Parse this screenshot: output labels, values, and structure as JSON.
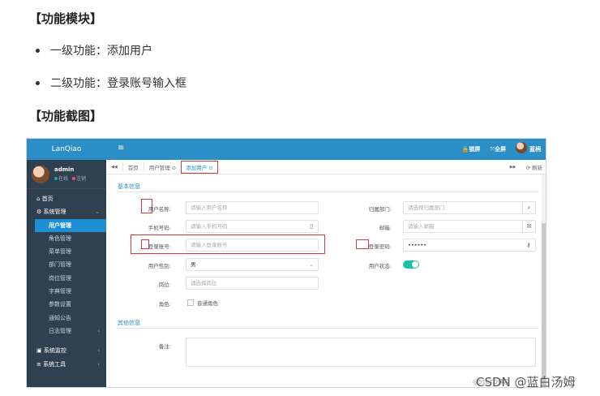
{
  "doc": {
    "heading1": "【功能模块】",
    "bullet1": "一级功能：添加用户",
    "bullet2": "二级功能：登录账号输入框",
    "heading2": "【功能截图】",
    "watermark": "CSDN @蓝白汤姆",
    "watermark_small": "@51CTO博客"
  },
  "app": {
    "brand": "LanQiao",
    "user_name": "admin",
    "user_status": "在线",
    "logout": "注销",
    "top_lock": "锁屏",
    "top_full": "全屏",
    "top_user": "蓝柄",
    "menu": [
      {
        "label": "首页",
        "type": "grp",
        "icon": "home-icon"
      },
      {
        "label": "系统管理",
        "type": "grp",
        "icon": "gear-icon",
        "arrow": "⌄"
      },
      {
        "label": "用户管理",
        "type": "active"
      },
      {
        "label": "角色管理",
        "type": "sub"
      },
      {
        "label": "菜单管理",
        "type": "sub"
      },
      {
        "label": "部门管理",
        "type": "sub"
      },
      {
        "label": "岗位管理",
        "type": "sub"
      },
      {
        "label": "字典管理",
        "type": "sub"
      },
      {
        "label": "参数设置",
        "type": "sub"
      },
      {
        "label": "通知公告",
        "type": "sub"
      },
      {
        "label": "日志管理",
        "type": "sub",
        "arrow": "‹"
      },
      {
        "label": "系统监控",
        "type": "grp",
        "icon": "video-icon",
        "arrow": "‹"
      },
      {
        "label": "系统工具",
        "type": "grp",
        "icon": "list-icon",
        "arrow": "‹"
      }
    ],
    "tabs": {
      "nav_left": "◀◀",
      "home": "首页",
      "user_mgmt": "用户管理 ⊙",
      "add_user": "添加用户 ⊙",
      "nav_right": "▶▶",
      "refresh": "⟳ 刷新"
    },
    "form": {
      "section_basic": "基本信息",
      "section_other": "其他信息",
      "username_label": "用户名称:",
      "username_ph": "请输入用户名称",
      "dept_label": "归属部门:",
      "dept_ph": "请选择归属部门",
      "phone_label": "手机号码:",
      "phone_ph": "请输入手机号码",
      "email_label": "邮箱:",
      "email_ph": "请输入邮箱",
      "account_label": "登录账号:",
      "account_ph": "请输入登录账号",
      "password_label": "登录密码:",
      "password_value": "••••••",
      "gender_label": "用户性别:",
      "gender_value": "男",
      "status_label": "用户状态:",
      "post_label": "岗位:",
      "post_ph": "请选择岗位",
      "role_label": "角色:",
      "role_option": "普通角色",
      "remark_label": "备注:"
    }
  }
}
